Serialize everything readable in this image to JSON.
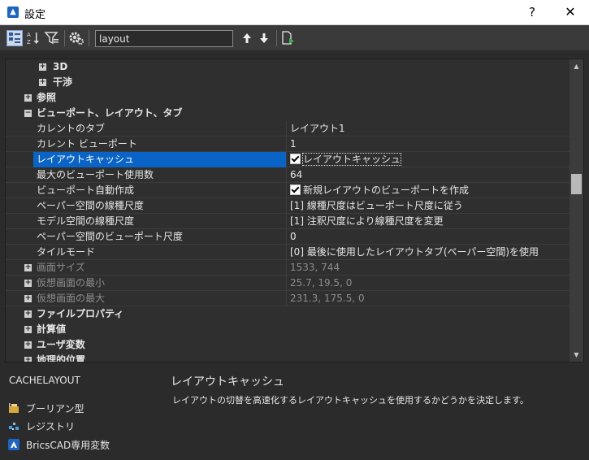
{
  "window": {
    "title": "設定",
    "help": "?",
    "close": "✕"
  },
  "toolbar": {
    "search_value": "layout"
  },
  "tree": {
    "cat_3d": "3D",
    "cat_interference": "干渉",
    "cat_reference": "参照",
    "cat_viewport": "ビューポート、レイアウト、タブ",
    "props": [
      {
        "label": "カレントのタブ",
        "value": "レイアウト1"
      },
      {
        "label": "カレント ビューポート",
        "value": "1"
      },
      {
        "label": "レイアウトキャッシュ",
        "value": "レイアウトキャッシュ"
      },
      {
        "label": "最大のビューポート使用数",
        "value": "64"
      },
      {
        "label": "ビューポート自動作成",
        "value": "新規レイアウトのビューポートを作成"
      },
      {
        "label": "ペーパー空間の線種尺度",
        "value": "[1] 線種尺度はビューポート尺度に従う"
      },
      {
        "label": "モデル空間の線種尺度",
        "value": "[1] 注釈尺度により線種尺度を変更"
      },
      {
        "label": "ペーパー空間のビューポート尺度",
        "value": "0"
      },
      {
        "label": "タイルモード",
        "value": "[0] 最後に使用したレイアウトタブ(ペーパー空間)を使用"
      }
    ],
    "disabled": [
      {
        "label": "画面サイズ",
        "value": "1533, 744"
      },
      {
        "label": "仮想画面の最小",
        "value": "25.7, 19.5, 0"
      },
      {
        "label": "仮想画面の最大",
        "value": "231.3, 175.5, 0"
      }
    ],
    "cat_file_props": "ファイルプロパティ",
    "cat_computed": "計算値",
    "cat_user_vars": "ユーザ変数",
    "cat_geo": "地理的位置"
  },
  "description": {
    "var_name": "CACHELAYOUT",
    "title": "レイアウトキャッシュ",
    "text": "レイアウトの切替を高速化するレイアウトキャッシュを使用するかどうかを決定します。"
  },
  "legend": {
    "boolean": "ブーリアン型",
    "registry": "レジストリ",
    "bricscad": "BricsCAD専用変数"
  },
  "colors": {
    "accent": "#0a64c8",
    "background": "#2b2b2b"
  }
}
